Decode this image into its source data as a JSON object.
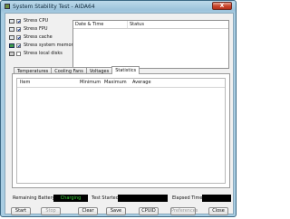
{
  "window": {
    "title": "System Stability Test - AIDA64",
    "close_glyph": "X"
  },
  "options": [
    {
      "label": "Stress CPU",
      "checked": true
    },
    {
      "label": "Stress FPU",
      "checked": true
    },
    {
      "label": "Stress cache",
      "checked": true
    },
    {
      "label": "Stress system memory",
      "checked": true
    },
    {
      "label": "Stress local disks",
      "checked": false
    }
  ],
  "log": {
    "columns": [
      "Date & Time",
      "Status"
    ]
  },
  "tabs": [
    "Temperatures",
    "Cooling Fans",
    "Voltages",
    "Statistics"
  ],
  "active_tab": "Statistics",
  "statistics": {
    "columns": [
      "Item",
      "Minimum",
      "Maximum",
      "Average"
    ]
  },
  "footer": {
    "remaining_battery_label": "Remaining Battery:",
    "remaining_battery_value": "Charging",
    "test_started_label": "Test Started:",
    "elapsed_time_label": "Elapsed Time:"
  },
  "buttons": {
    "start": "Start",
    "stop": "Stop",
    "clear": "Clear",
    "save": "Save",
    "cpuid": "CPUID",
    "preferences": "Preferences",
    "close": "Close"
  }
}
